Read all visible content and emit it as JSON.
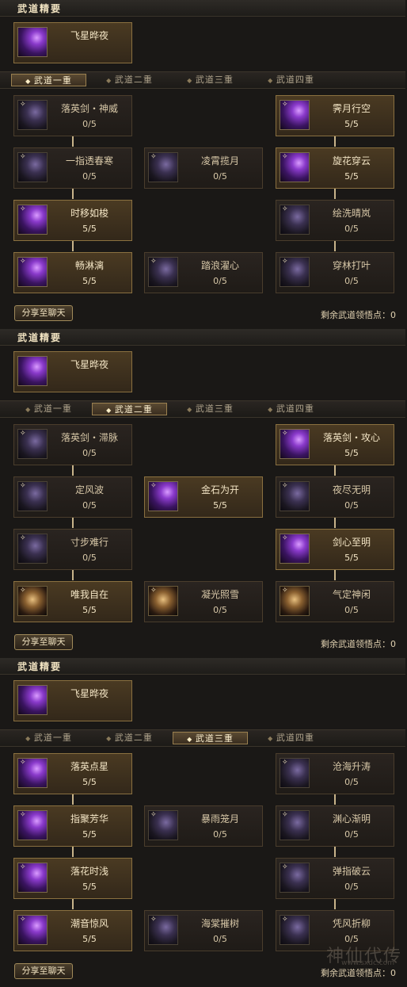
{
  "panels": [
    {
      "section_title": "武道精要",
      "featured": {
        "name": "飞星晔夜"
      },
      "tabs": [
        "武道一重",
        "武道二重",
        "武道三重",
        "武道四重"
      ],
      "active_tab": 0,
      "share_label": "分享至聊天",
      "remaining": "剩余武道领悟点：0",
      "skills": [
        {
          "name": "落英剑・神威",
          "level": "0/5",
          "state": "dim",
          "icon": "dark",
          "col": 0,
          "row": 0
        },
        {
          "name": "霁月行空",
          "level": "5/5",
          "state": "lit",
          "icon": "purple",
          "col": 2,
          "row": 0
        },
        {
          "name": "一指透春寒",
          "level": "0/5",
          "state": "dim",
          "icon": "dark",
          "col": 0,
          "row": 1
        },
        {
          "name": "凌霄揽月",
          "level": "0/5",
          "state": "dim",
          "icon": "dark",
          "col": 1,
          "row": 1
        },
        {
          "name": "旋花穿云",
          "level": "5/5",
          "state": "lit",
          "icon": "purple",
          "col": 2,
          "row": 1
        },
        {
          "name": "时移如梭",
          "level": "5/5",
          "state": "lit",
          "icon": "purple",
          "col": 0,
          "row": 2
        },
        {
          "name": "绘洗晴岚",
          "level": "0/5",
          "state": "dim",
          "icon": "dark",
          "col": 2,
          "row": 2
        },
        {
          "name": "畅淋漓",
          "level": "5/5",
          "state": "lit",
          "icon": "purple",
          "col": 0,
          "row": 3
        },
        {
          "name": "踏浪濯心",
          "level": "0/5",
          "state": "dim",
          "icon": "dark",
          "col": 1,
          "row": 3
        },
        {
          "name": "穿林打叶",
          "level": "0/5",
          "state": "dim",
          "icon": "dark",
          "col": 2,
          "row": 3
        }
      ]
    },
    {
      "section_title": "武道精要",
      "featured": {
        "name": "飞星晔夜"
      },
      "tabs": [
        "武道一重",
        "武道二重",
        "武道三重",
        "武道四重"
      ],
      "active_tab": 1,
      "share_label": "分享至聊天",
      "remaining": "剩余武道领悟点：0",
      "skills": [
        {
          "name": "落英剑・滞脉",
          "level": "0/5",
          "state": "dim",
          "icon": "dark",
          "col": 0,
          "row": 0
        },
        {
          "name": "落英剑・攻心",
          "level": "5/5",
          "state": "lit",
          "icon": "purple",
          "col": 2,
          "row": 0
        },
        {
          "name": "定风波",
          "level": "0/5",
          "state": "dim",
          "icon": "dark",
          "col": 0,
          "row": 1
        },
        {
          "name": "金石为开",
          "level": "5/5",
          "state": "lit",
          "icon": "purple",
          "col": 1,
          "row": 1
        },
        {
          "name": "夜尽无明",
          "level": "0/5",
          "state": "dim",
          "icon": "dark",
          "col": 2,
          "row": 1
        },
        {
          "name": "寸步难行",
          "level": "0/5",
          "state": "dim",
          "icon": "dark",
          "col": 0,
          "row": 2
        },
        {
          "name": "剑心至明",
          "level": "5/5",
          "state": "lit",
          "icon": "purple",
          "col": 2,
          "row": 2
        },
        {
          "name": "唯我自在",
          "level": "5/5",
          "state": "lit",
          "icon": "gold",
          "col": 0,
          "row": 3
        },
        {
          "name": "凝光照雪",
          "level": "0/5",
          "state": "dim",
          "icon": "gold",
          "col": 1,
          "row": 3
        },
        {
          "name": "气定神闲",
          "level": "0/5",
          "state": "dim",
          "icon": "gold",
          "col": 2,
          "row": 3
        }
      ]
    },
    {
      "section_title": "武道精要",
      "featured": {
        "name": "飞星晔夜"
      },
      "tabs": [
        "武道一重",
        "武道二重",
        "武道三重",
        "武道四重"
      ],
      "active_tab": 2,
      "share_label": "分享至聊天",
      "remaining": "剩余武道领悟点：0",
      "skills": [
        {
          "name": "落英点星",
          "level": "5/5",
          "state": "lit",
          "icon": "purple",
          "col": 0,
          "row": 0
        },
        {
          "name": "沧海升涛",
          "level": "0/5",
          "state": "dim",
          "icon": "dark",
          "col": 2,
          "row": 0
        },
        {
          "name": "指聚芳华",
          "level": "5/5",
          "state": "lit",
          "icon": "purple",
          "col": 0,
          "row": 1
        },
        {
          "name": "暴雨笼月",
          "level": "0/5",
          "state": "dim",
          "icon": "dark",
          "col": 1,
          "row": 1
        },
        {
          "name": "渊心渐明",
          "level": "0/5",
          "state": "dim",
          "icon": "dark",
          "col": 2,
          "row": 1
        },
        {
          "name": "落花时浅",
          "level": "5/5",
          "state": "lit",
          "icon": "purple",
          "col": 0,
          "row": 2
        },
        {
          "name": "弹指破云",
          "level": "0/5",
          "state": "dim",
          "icon": "dark",
          "col": 2,
          "row": 2
        },
        {
          "name": "潮音惊风",
          "level": "5/5",
          "state": "lit",
          "icon": "purple",
          "col": 0,
          "row": 3
        },
        {
          "name": "海棠摧树",
          "level": "0/5",
          "state": "dim",
          "icon": "dark",
          "col": 1,
          "row": 3
        },
        {
          "name": "凭风折柳",
          "level": "0/5",
          "state": "dim",
          "icon": "dark",
          "col": 2,
          "row": 3
        }
      ]
    }
  ],
  "watermark": {
    "text": "神仙代传",
    "url": "www.sxdc.com"
  }
}
